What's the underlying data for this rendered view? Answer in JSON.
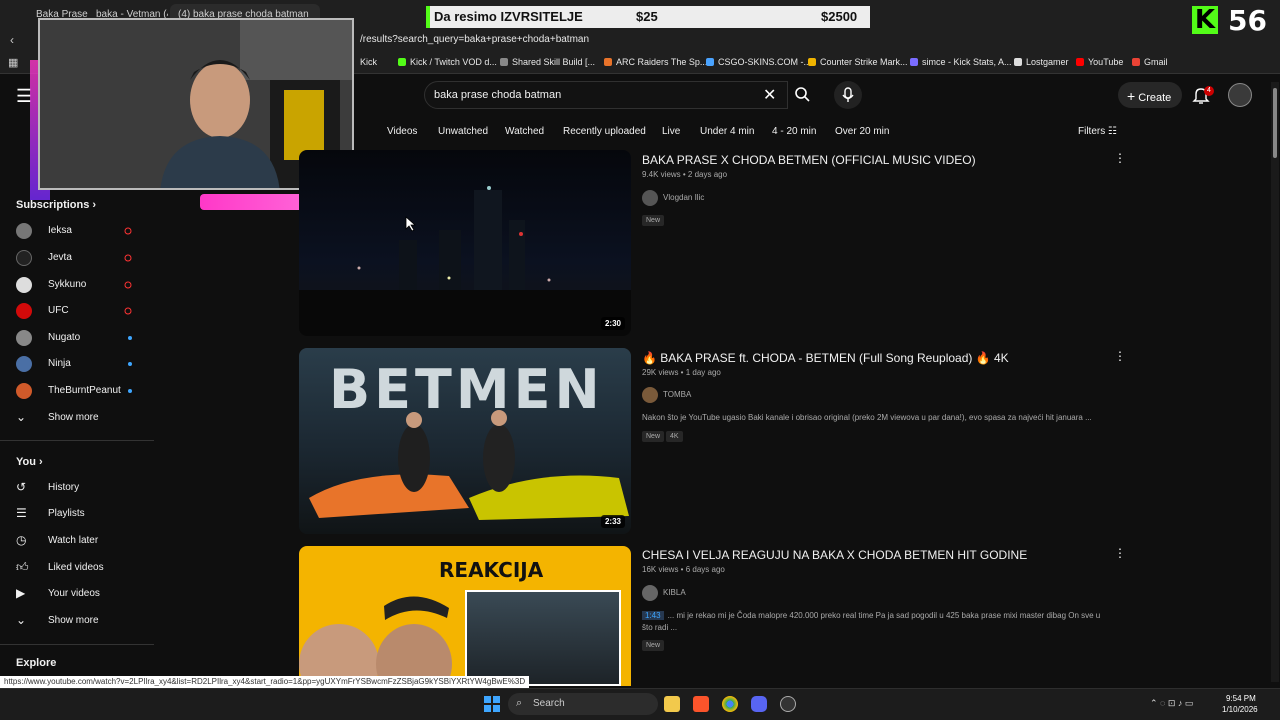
{
  "browser": {
    "tabs": [
      "Baka Prase",
      "baka - Vetman (4)",
      "(4) baka prase choda batman"
    ],
    "url": "/results?search_query=baka+prase+choda+batman",
    "bookmarks": [
      "Kick",
      "Kick / Twitch VOD d...",
      "Shared Skill Build [...",
      "ARC Raiders The Sp...",
      "CSGO-SKINS.COM -...",
      "Counter Strike Mark...",
      "simce - Kick Stats, A...",
      "Lostgamer",
      "YouTube",
      "Gmail"
    ],
    "status_url": "https://www.youtube.com/watch?v=2LPIlra_xy4&list=RD2LPIlra_xy4&start_radio=1&pp=ygUXYmFrYSBwcmFzZSBjaG9kYSBiYXRtYW4gBwE%3D"
  },
  "overlay": {
    "donation_label": "Da resimo IZVRSITELJE",
    "donation_current": "$25",
    "donation_goal": "$2500",
    "kick_logo": "K",
    "viewer_count": "56"
  },
  "header": {
    "search_query": "baka prase choda batman",
    "create_label": "Create",
    "notification_count": "4"
  },
  "chips": [
    "Videos",
    "Unwatched",
    "Watched",
    "Recently uploaded",
    "Live",
    "Under 4 min",
    "4 - 20 min",
    "Over 20 min"
  ],
  "filters_label": "Filters",
  "sidebar": {
    "subscriptions_label": "Subscriptions",
    "subscriptions": [
      {
        "name": "Ieksa",
        "status": "live"
      },
      {
        "name": "Jevta",
        "status": "live"
      },
      {
        "name": "Sykkuno",
        "status": "live"
      },
      {
        "name": "UFC",
        "status": "live"
      },
      {
        "name": "Nugato",
        "status": "new"
      },
      {
        "name": "Ninja",
        "status": "new"
      },
      {
        "name": "TheBurntPeanut",
        "status": "new"
      }
    ],
    "show_more_1": "Show more",
    "you_label": "You",
    "you_items": [
      "History",
      "Playlists",
      "Watch later",
      "Liked videos",
      "Your videos"
    ],
    "show_more_2": "Show more",
    "explore_label": "Explore"
  },
  "results": [
    {
      "title": "BAKA PRASE X CHODA BETMEN (OFFICIAL MUSIC VIDEO)",
      "meta": "9.4K views • 2 days ago",
      "channel": "Vlogdan Ilic",
      "badges": [
        "New"
      ],
      "duration": "2:30",
      "description": ""
    },
    {
      "title": "🔥 BAKA PRASE ft. CHODA - BETMEN (Full Song Reupload) 🔥 4K",
      "meta": "29K views • 1 day ago",
      "channel": "TOMBA",
      "badges": [
        "New",
        "4K"
      ],
      "duration": "2:33",
      "thumb_text": "BETMEN",
      "description": "Nakon što je YouTube ugasio Baki kanale i obrisao original (preko 2M viewova u par dana!), evo spasa za najveći hit januara ..."
    },
    {
      "title": "CHESA I VELJA REAGUJU NA BAKA X CHODA BETMEN HIT GODINE",
      "meta": "16K views • 6 days ago",
      "channel": "KIBLA",
      "badges": [
        "New"
      ],
      "duration": "",
      "thumb_text": "REAKCIJA",
      "timestamp": "1:43",
      "description": "... mi je rekao mi je Čoda malopre 420.000 preko real time Pa ja sad pogodil u 425 baka prase mixi master dibag On sve u što radi ..."
    }
  ],
  "taskbar": {
    "search_label": "Search",
    "time": "9:54 PM",
    "date": "1/10/2026"
  }
}
